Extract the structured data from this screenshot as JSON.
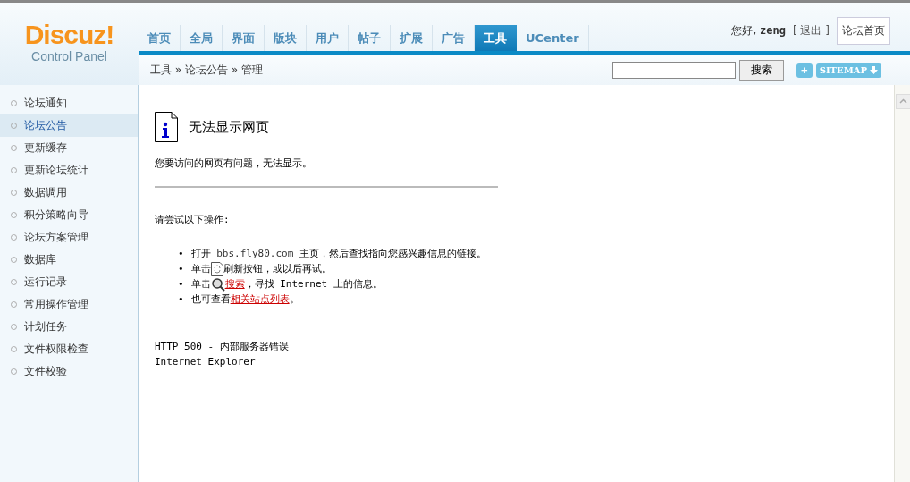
{
  "logo": {
    "title": "Discuz!",
    "subtitle": "Control Panel"
  },
  "nav": [
    {
      "label": "首页",
      "selected": false
    },
    {
      "label": "全局",
      "selected": false
    },
    {
      "label": "界面",
      "selected": false
    },
    {
      "label": "版块",
      "selected": false
    },
    {
      "label": "用户",
      "selected": false
    },
    {
      "label": "帖子",
      "selected": false
    },
    {
      "label": "扩展",
      "selected": false
    },
    {
      "label": "广告",
      "selected": false
    },
    {
      "label": "工具",
      "selected": true
    },
    {
      "label": "UCenter",
      "selected": false
    }
  ],
  "user": {
    "greeting": "您好,",
    "username": "zeng",
    "logout": "[ 退出 ]",
    "home_button": "论坛首页"
  },
  "breadcrumb": "工具 » 论坛公告 » 管理",
  "search": {
    "button": "搜索"
  },
  "add_button": "+",
  "sitemap_button": "SITEMAP",
  "sidebar": {
    "items": [
      {
        "label": "论坛通知",
        "selected": false
      },
      {
        "label": "论坛公告",
        "selected": true
      },
      {
        "label": "更新缓存",
        "selected": false
      },
      {
        "label": "更新论坛统计",
        "selected": false
      },
      {
        "label": "数据调用",
        "selected": false
      },
      {
        "label": "积分策略向导",
        "selected": false
      },
      {
        "label": "论坛方案管理",
        "selected": false
      },
      {
        "label": "数据库",
        "selected": false
      },
      {
        "label": "运行记录",
        "selected": false
      },
      {
        "label": "常用操作管理",
        "selected": false
      },
      {
        "label": "计划任务",
        "selected": false
      },
      {
        "label": "文件权限检查",
        "selected": false
      },
      {
        "label": "文件校验",
        "selected": false
      }
    ]
  },
  "error_page": {
    "title": "无法显示网页",
    "message": "您要访问的网页有问题，无法显示。",
    "prompt": "请尝试以下操作:",
    "suggestions": [
      {
        "bullet": "•",
        "parts": [
          {
            "kind": "text",
            "text": "打开 "
          },
          {
            "kind": "url",
            "text": "bbs.fly80.com"
          },
          {
            "kind": "text",
            "text": "  主页，然后查找指向您感兴趣信息的链接。"
          }
        ]
      },
      {
        "bullet": "•",
        "parts": [
          {
            "kind": "text",
            "text": "单击"
          },
          {
            "kind": "refresh-icon"
          },
          {
            "kind": "text",
            "text": "刷新按钮，或以后再试。"
          }
        ]
      },
      {
        "bullet": "•",
        "parts": [
          {
            "kind": "text",
            "text": "单击"
          },
          {
            "kind": "search-icon"
          },
          {
            "kind": "link",
            "text": "搜索"
          },
          {
            "kind": "text",
            "text": "，寻找 Internet 上的信息。"
          }
        ]
      },
      {
        "bullet": "•",
        "parts": [
          {
            "kind": "text",
            "text": "也可查看"
          },
          {
            "kind": "link",
            "text": "相关站点列表"
          },
          {
            "kind": "text",
            "text": "。"
          }
        ]
      }
    ],
    "error_code": "HTTP 500 - 内部服务器错误",
    "browser": "Internet Explorer"
  }
}
